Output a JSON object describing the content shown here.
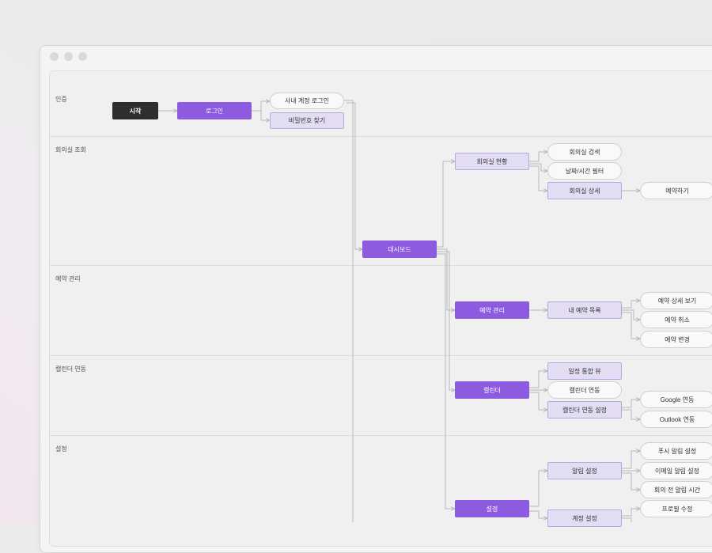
{
  "lanes": {
    "auth": "인증",
    "room_lookup": "회의실 조회",
    "reservation": "예약 관리",
    "calendar": "캘린더 연동",
    "settings": "설정"
  },
  "nodes": {
    "start": "시작",
    "login": "로그인",
    "company_login": "사내 계정 로그인",
    "find_password": "비밀번호 찾기",
    "dashboard": "대시보드",
    "room_status": "회의실 현황",
    "room_search": "회의실 검색",
    "date_time_filter": "날짜/시간 필터",
    "room_detail": "회의실 상세",
    "book": "예약하기",
    "reservation_mgmt": "예약 관리",
    "my_reservations": "내 예약 목록",
    "reservation_detail": "예약 상세 보기",
    "cancel_reservation": "예약 취소",
    "change_reservation": "예약 변경",
    "calendar": "캘린더",
    "schedule_view": "일정 통합 뷰",
    "calendar_link": "캘린더 연동",
    "calendar_link_settings": "캘린더 연동 설정",
    "google_link": "Google 연동",
    "outlook_link": "Outlook 연동",
    "settings": "설정",
    "notification_settings": "알림 설정",
    "push_settings": "푸시 알림 설정",
    "email_settings": "이메일 알림 설정",
    "pre_meeting_time": "회의 전 알림 시간",
    "account_settings": "계정 설정",
    "profile_edit": "프로필 수정"
  },
  "colors": {
    "main": "#8c5be0",
    "sub": "#e3ddf4",
    "start": "#2e2e2e",
    "wire": "#b9b9b9"
  }
}
